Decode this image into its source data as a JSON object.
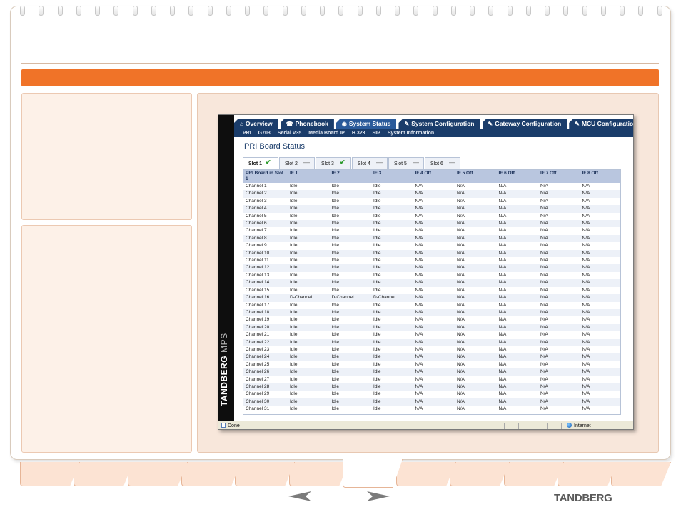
{
  "browser": {
    "brand": {
      "name": "TANDBERG",
      "suffix": "MPS"
    },
    "main_tabs": [
      {
        "icon": "home-icon",
        "glyph": "⌂",
        "label": "Overview",
        "active": false
      },
      {
        "icon": "phonebook-icon",
        "glyph": "☎",
        "label": "Phonebook",
        "active": false
      },
      {
        "icon": "eye-icon",
        "glyph": "◉",
        "label": "System Status",
        "active": true
      },
      {
        "icon": "wrench-icon",
        "glyph": "✎",
        "label": "System Configuration",
        "active": false
      },
      {
        "icon": "wrench-icon",
        "glyph": "✎",
        "label": "Gateway Configuration",
        "active": false
      },
      {
        "icon": "wrench-icon",
        "glyph": "✎",
        "label": "MCU Configuration",
        "active": false
      }
    ],
    "sub_nav": [
      "PRI",
      "G703",
      "Serial V35",
      "Media Board IP",
      "H.323",
      "SIP",
      "System Information"
    ],
    "page_title": "PRI Board Status",
    "slot_tabs": [
      {
        "label": "Slot 1",
        "mark": "✔",
        "mark_type": "check",
        "active": true
      },
      {
        "label": "Slot 2",
        "mark": "—",
        "mark_type": "dash",
        "active": false
      },
      {
        "label": "Slot 3",
        "mark": "✔",
        "mark_type": "check",
        "active": false
      },
      {
        "label": "Slot 4",
        "mark": "—",
        "mark_type": "dash",
        "active": false
      },
      {
        "label": "Slot 5",
        "mark": "—",
        "mark_type": "dash",
        "active": false
      },
      {
        "label": "Slot 6",
        "mark": "—",
        "mark_type": "dash",
        "active": false
      }
    ],
    "table": {
      "columns": [
        "PRI Board in Slot 1",
        "IF 1",
        "IF 2",
        "IF 3",
        "IF 4 Off",
        "IF 5 Off",
        "IF 6 Off",
        "IF 7 Off",
        "IF 8 Off"
      ],
      "rows": [
        [
          "Channel 1",
          "Idle",
          "Idle",
          "Idle",
          "N/A",
          "N/A",
          "N/A",
          "N/A",
          "N/A"
        ],
        [
          "Channel 2",
          "Idle",
          "Idle",
          "Idle",
          "N/A",
          "N/A",
          "N/A",
          "N/A",
          "N/A"
        ],
        [
          "Channel 3",
          "Idle",
          "Idle",
          "Idle",
          "N/A",
          "N/A",
          "N/A",
          "N/A",
          "N/A"
        ],
        [
          "Channel 4",
          "Idle",
          "Idle",
          "Idle",
          "N/A",
          "N/A",
          "N/A",
          "N/A",
          "N/A"
        ],
        [
          "Channel 5",
          "Idle",
          "Idle",
          "Idle",
          "N/A",
          "N/A",
          "N/A",
          "N/A",
          "N/A"
        ],
        [
          "Channel 6",
          "Idle",
          "Idle",
          "Idle",
          "N/A",
          "N/A",
          "N/A",
          "N/A",
          "N/A"
        ],
        [
          "Channel 7",
          "Idle",
          "Idle",
          "Idle",
          "N/A",
          "N/A",
          "N/A",
          "N/A",
          "N/A"
        ],
        [
          "Channel 8",
          "Idle",
          "Idle",
          "Idle",
          "N/A",
          "N/A",
          "N/A",
          "N/A",
          "N/A"
        ],
        [
          "Channel 9",
          "Idle",
          "Idle",
          "Idle",
          "N/A",
          "N/A",
          "N/A",
          "N/A",
          "N/A"
        ],
        [
          "Channel 10",
          "Idle",
          "Idle",
          "Idle",
          "N/A",
          "N/A",
          "N/A",
          "N/A",
          "N/A"
        ],
        [
          "Channel 11",
          "Idle",
          "Idle",
          "Idle",
          "N/A",
          "N/A",
          "N/A",
          "N/A",
          "N/A"
        ],
        [
          "Channel 12",
          "Idle",
          "Idle",
          "Idle",
          "N/A",
          "N/A",
          "N/A",
          "N/A",
          "N/A"
        ],
        [
          "Channel 13",
          "Idle",
          "Idle",
          "Idle",
          "N/A",
          "N/A",
          "N/A",
          "N/A",
          "N/A"
        ],
        [
          "Channel 14",
          "Idle",
          "Idle",
          "Idle",
          "N/A",
          "N/A",
          "N/A",
          "N/A",
          "N/A"
        ],
        [
          "Channel 15",
          "Idle",
          "Idle",
          "Idle",
          "N/A",
          "N/A",
          "N/A",
          "N/A",
          "N/A"
        ],
        [
          "Channel 16",
          "D-Channel",
          "D-Channel",
          "D-Channel",
          "N/A",
          "N/A",
          "N/A",
          "N/A",
          "N/A"
        ],
        [
          "Channel 17",
          "Idle",
          "Idle",
          "Idle",
          "N/A",
          "N/A",
          "N/A",
          "N/A",
          "N/A"
        ],
        [
          "Channel 18",
          "Idle",
          "Idle",
          "Idle",
          "N/A",
          "N/A",
          "N/A",
          "N/A",
          "N/A"
        ],
        [
          "Channel 19",
          "Idle",
          "Idle",
          "Idle",
          "N/A",
          "N/A",
          "N/A",
          "N/A",
          "N/A"
        ],
        [
          "Channel 20",
          "Idle",
          "Idle",
          "Idle",
          "N/A",
          "N/A",
          "N/A",
          "N/A",
          "N/A"
        ],
        [
          "Channel 21",
          "Idle",
          "Idle",
          "Idle",
          "N/A",
          "N/A",
          "N/A",
          "N/A",
          "N/A"
        ],
        [
          "Channel 22",
          "Idle",
          "Idle",
          "Idle",
          "N/A",
          "N/A",
          "N/A",
          "N/A",
          "N/A"
        ],
        [
          "Channel 23",
          "Idle",
          "Idle",
          "Idle",
          "N/A",
          "N/A",
          "N/A",
          "N/A",
          "N/A"
        ],
        [
          "Channel 24",
          "Idle",
          "Idle",
          "Idle",
          "N/A",
          "N/A",
          "N/A",
          "N/A",
          "N/A"
        ],
        [
          "Channel 25",
          "Idle",
          "Idle",
          "Idle",
          "N/A",
          "N/A",
          "N/A",
          "N/A",
          "N/A"
        ],
        [
          "Channel 26",
          "Idle",
          "Idle",
          "Idle",
          "N/A",
          "N/A",
          "N/A",
          "N/A",
          "N/A"
        ],
        [
          "Channel 27",
          "Idle",
          "Idle",
          "Idle",
          "N/A",
          "N/A",
          "N/A",
          "N/A",
          "N/A"
        ],
        [
          "Channel 28",
          "Idle",
          "Idle",
          "Idle",
          "N/A",
          "N/A",
          "N/A",
          "N/A",
          "N/A"
        ],
        [
          "Channel 29",
          "Idle",
          "Idle",
          "Idle",
          "N/A",
          "N/A",
          "N/A",
          "N/A",
          "N/A"
        ],
        [
          "Channel 30",
          "Idle",
          "Idle",
          "Idle",
          "N/A",
          "N/A",
          "N/A",
          "N/A",
          "N/A"
        ],
        [
          "Channel 31",
          "Idle",
          "Idle",
          "Idle",
          "N/A",
          "N/A",
          "N/A",
          "N/A",
          "N/A"
        ]
      ]
    },
    "statusbar": {
      "left": "Done",
      "zone": "Internet"
    }
  },
  "footer": {
    "logo": "TANDBERG",
    "prev_icon": "arrow-left-icon",
    "next_icon": "arrow-right-icon"
  },
  "colors": {
    "orange_bar": "#f07328",
    "panel": "#f8e7db",
    "nav_blue": "#1a3c6a",
    "header_blue": "#b9c6df"
  }
}
